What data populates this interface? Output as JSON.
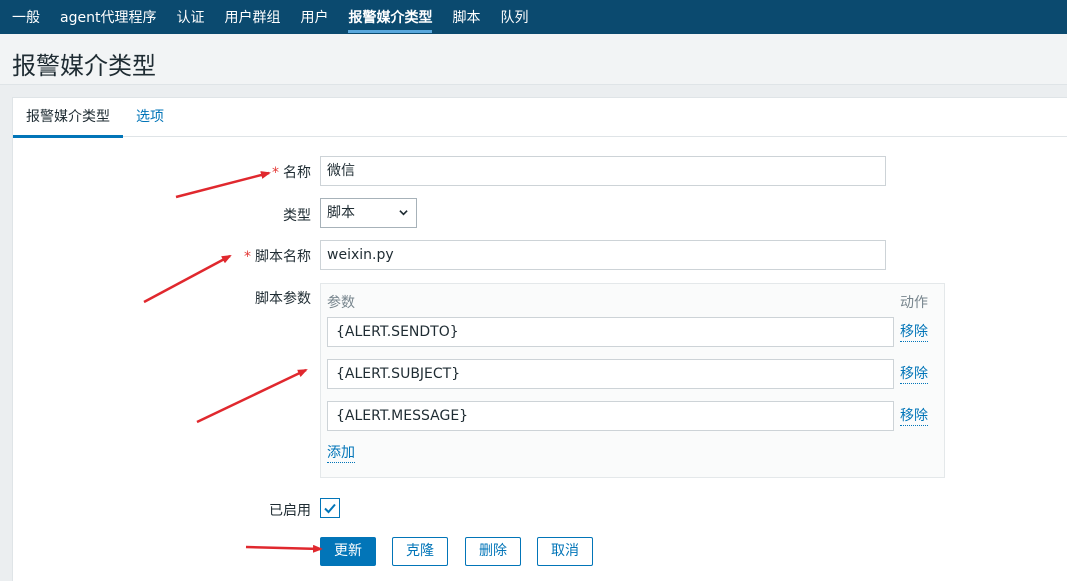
{
  "nav": {
    "items": [
      "一般",
      "agent代理程序",
      "认证",
      "用户群组",
      "用户",
      "报警媒介类型",
      "脚本",
      "队列"
    ],
    "active_index": 5
  },
  "page": {
    "title": "报警媒介类型"
  },
  "tabs": [
    {
      "label": "报警媒介类型",
      "active": true
    },
    {
      "label": "选项",
      "active": false
    }
  ],
  "form": {
    "name": {
      "label": "名称",
      "required": true,
      "value": "微信"
    },
    "type": {
      "label": "类型",
      "value": "脚本"
    },
    "script_name": {
      "label": "脚本名称",
      "required": true,
      "value": "weixin.py"
    },
    "script_params": {
      "label": "脚本参数",
      "col_param": "参数",
      "col_action": "动作",
      "params": [
        "{ALERT.SENDTO}",
        "{ALERT.SUBJECT}",
        "{ALERT.MESSAGE}"
      ],
      "remove_label": "移除",
      "add_label": "添加"
    },
    "enabled": {
      "label": "已启用",
      "checked": true
    }
  },
  "buttons": {
    "update": "更新",
    "clone": "克隆",
    "delete": "删除",
    "cancel": "取消"
  },
  "colors": {
    "nav_bg": "#0b4a6f",
    "accent": "#0275b8",
    "required": "#e33734",
    "annotation_arrow": "#e0282e"
  }
}
